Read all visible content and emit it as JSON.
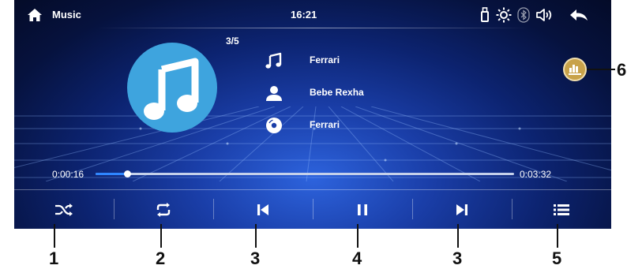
{
  "status_bar": {
    "app_title": "Music",
    "clock": "16:21",
    "icons": [
      "home-icon",
      "usb-icon",
      "brightness-icon",
      "bluetooth-icon",
      "volume-icon",
      "back-arrow-icon"
    ]
  },
  "track": {
    "index": "3/5",
    "title": "Ferrari",
    "artist": "Bebe Rexha",
    "album": "Ferrari"
  },
  "playback": {
    "elapsed": "0:00:16",
    "duration": "0:03:32",
    "progress_fraction": 0.075
  },
  "controls": [
    {
      "name": "shuffle-button",
      "icon": "shuffle-icon"
    },
    {
      "name": "repeat-button",
      "icon": "repeat-icon"
    },
    {
      "name": "previous-button",
      "icon": "skip-previous-icon"
    },
    {
      "name": "pause-button",
      "icon": "pause-icon"
    },
    {
      "name": "next-button",
      "icon": "skip-next-icon"
    },
    {
      "name": "playlist-button",
      "icon": "list-icon"
    }
  ],
  "eq_button": {
    "icon": "equalizer-icon"
  },
  "callouts": {
    "shuffle": "1",
    "repeat": "2",
    "previous": "3",
    "pause": "4",
    "next": "3",
    "playlist": "5",
    "equalizer": "6"
  },
  "colors": {
    "accent": "#2f86ff",
    "album_art": "#3ea4de",
    "eq_button": "#c8a24a",
    "background_dark": "#06123e"
  }
}
